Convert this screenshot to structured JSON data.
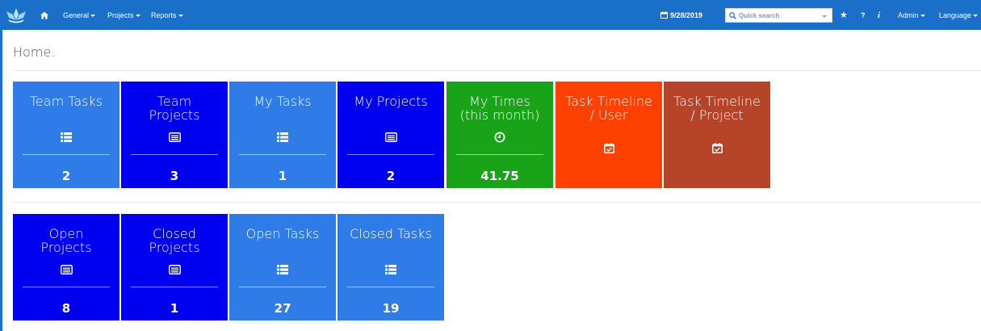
{
  "nav": {
    "general": "General",
    "projects": "Projects",
    "reports": "Reports",
    "date": "9/28/2019",
    "search_placeholder": "Quick search",
    "help": "?",
    "info": "i",
    "admin": "Admin",
    "language": "Language"
  },
  "page": {
    "title": "Home."
  },
  "colors": {
    "navbar": "#1a6fc9",
    "light_blue": "#2f7ce8",
    "navy": "#0000f0",
    "green": "#19a319",
    "orange": "#fe4101",
    "brown": "#b54428"
  },
  "tiles_row1": [
    {
      "label": "Team Tasks",
      "icon": "list-icon",
      "count": "2"
    },
    {
      "label": "Team Projects",
      "icon": "projects-icon",
      "count": "3"
    },
    {
      "label": "My Tasks",
      "icon": "list-icon",
      "count": "1"
    },
    {
      "label": "My Projects",
      "icon": "projects-icon",
      "count": "2"
    },
    {
      "label": "My Times (this month)",
      "icon": "clock-icon",
      "count": "41.75"
    },
    {
      "label": "Task Timeline / User",
      "icon": "calendar-check-icon",
      "count": ""
    },
    {
      "label": "Task Timeline / Project",
      "icon": "calendar-check-icon",
      "count": ""
    }
  ],
  "tiles_row2": [
    {
      "label": "Open Projects",
      "icon": "projects-icon",
      "count": "8"
    },
    {
      "label": "Closed Projects",
      "icon": "projects-icon",
      "count": "1"
    },
    {
      "label": "Open Tasks",
      "icon": "list-icon",
      "count": "27"
    },
    {
      "label": "Closed Tasks",
      "icon": "list-icon",
      "count": "19"
    }
  ]
}
